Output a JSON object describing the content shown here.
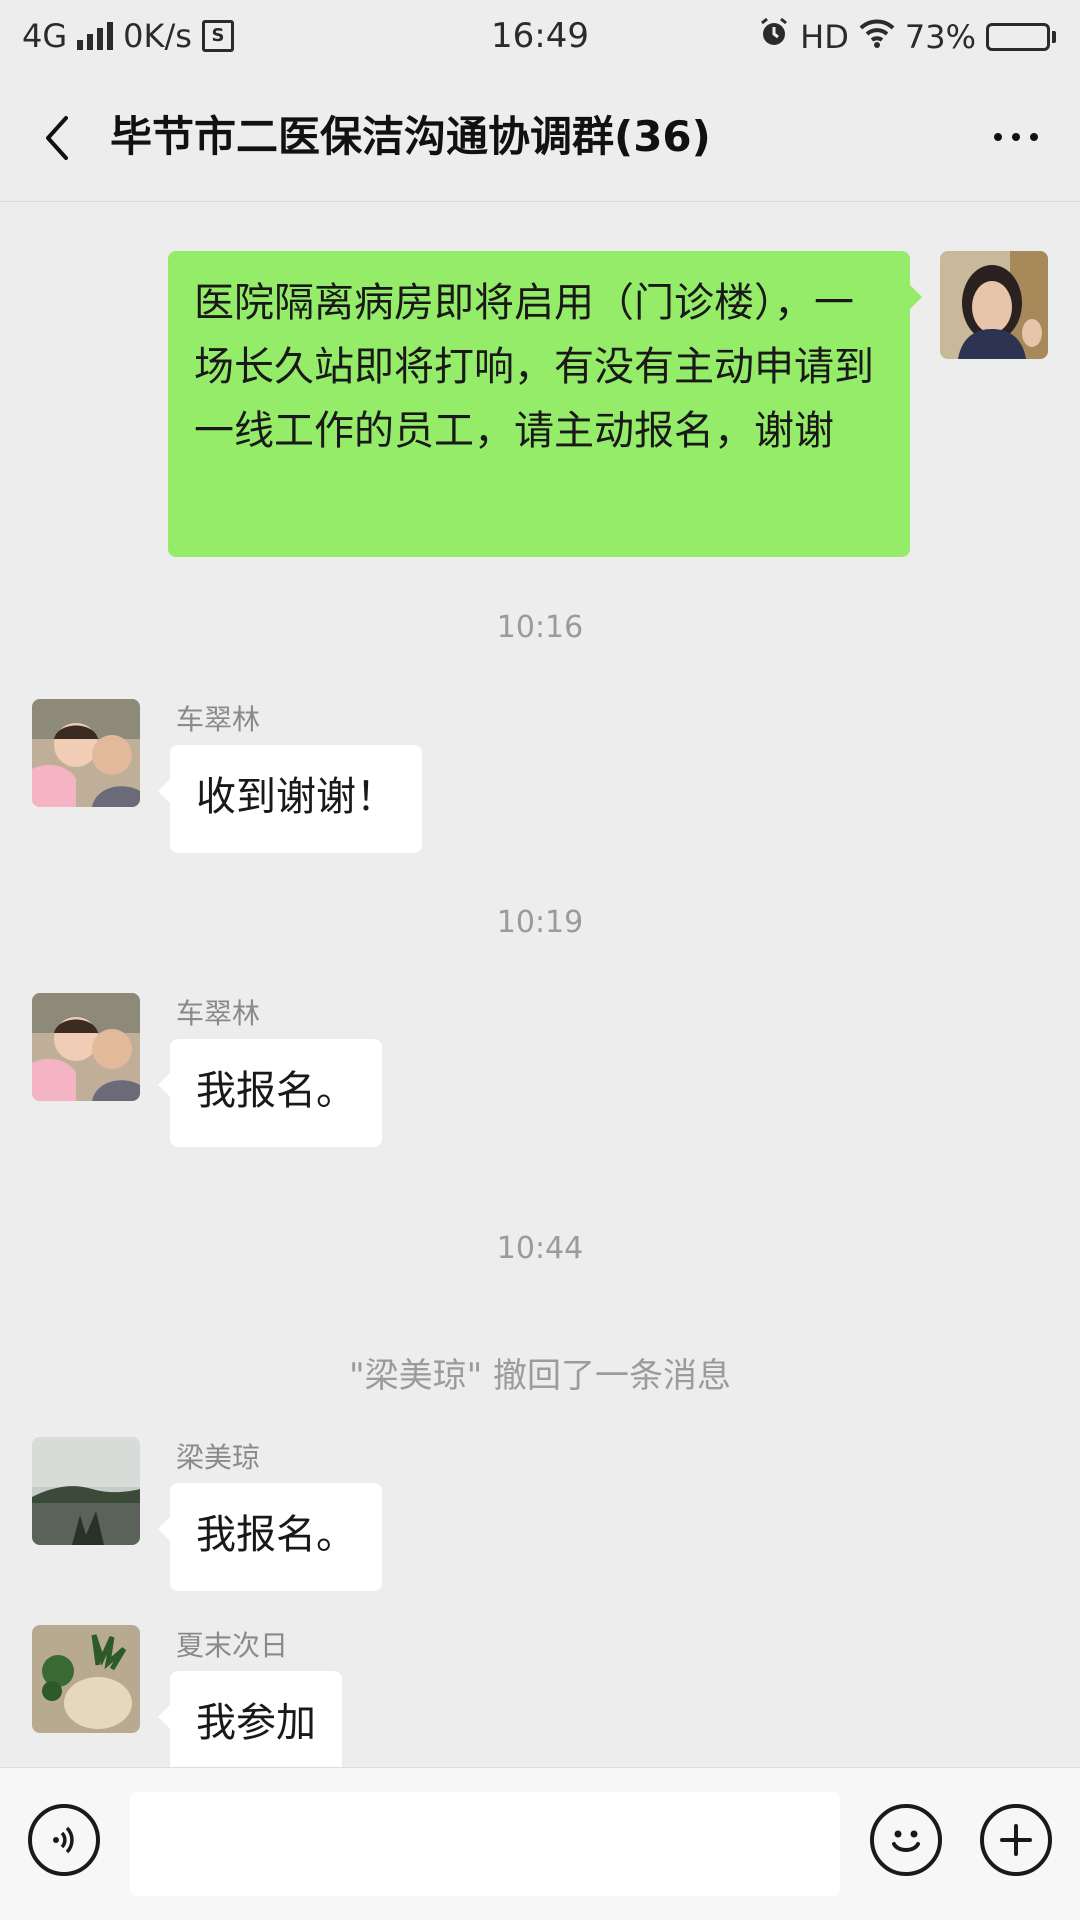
{
  "status_bar": {
    "network": "4G",
    "speed": "0K/s",
    "s_icon": "S",
    "time": "16:49",
    "hd": "HD",
    "battery": "73%",
    "battery_level": 0.73
  },
  "header": {
    "title": "毕节市二医保洁沟通协调群(36)"
  },
  "messages": {
    "m0": {
      "text": "医院隔离病房即将启用（门诊楼），一场长久站即将打响，有没有主动申请到一线工作的员工，请主动报名，谢谢"
    },
    "t1": "10:16",
    "m1": {
      "sender": "车翠林",
      "text": "收到谢谢！"
    },
    "t2": "10:19",
    "m2": {
      "sender": "车翠林",
      "text": "我报名。"
    },
    "t3": "10:44",
    "recall": "\"梁美琼\" 撤回了一条消息",
    "m3": {
      "sender": "梁美琼",
      "text": "我报名。"
    },
    "m4": {
      "sender": "夏末次日",
      "text": "我参加"
    }
  },
  "input_bar": {
    "value": "",
    "icons": [
      "voice-icon",
      "emoji-icon",
      "plus-icon"
    ]
  },
  "colors": {
    "background": "#ededed",
    "own_bubble": "#95ec69",
    "other_bubble": "#ffffff",
    "meta_text": "#9b9b9b"
  }
}
